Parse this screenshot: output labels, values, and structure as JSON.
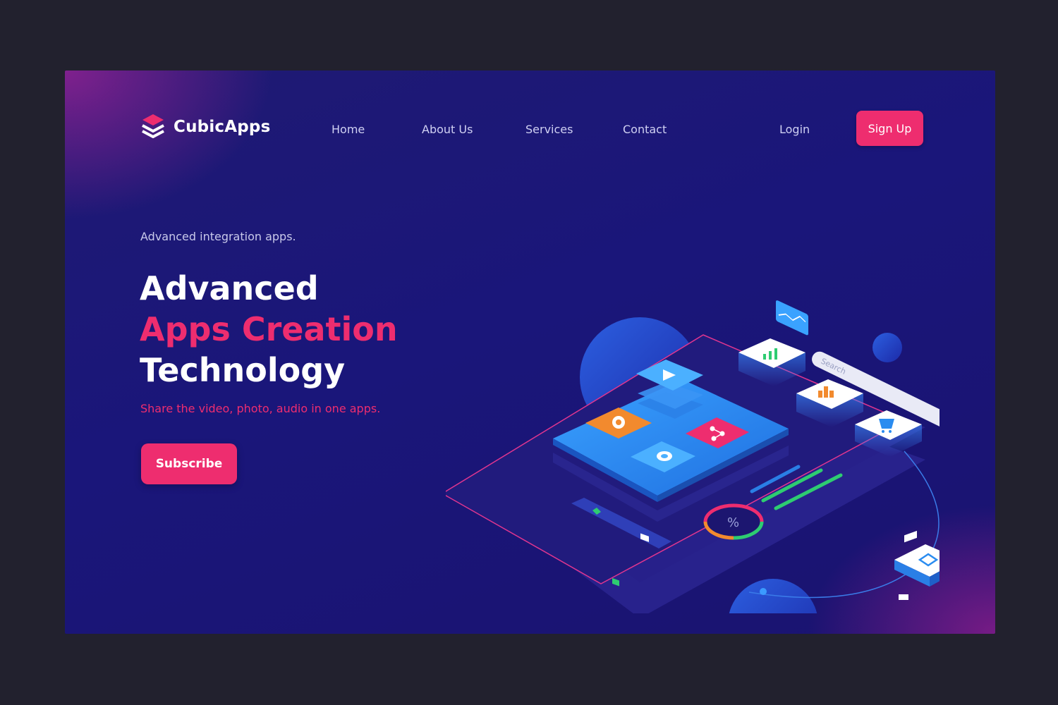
{
  "brand": {
    "name": "CubicApps",
    "logo_icon": "stacked-layers-icon"
  },
  "nav": {
    "items": [
      {
        "label": "Home"
      },
      {
        "label": "About Us"
      },
      {
        "label": "Services"
      },
      {
        "label": "Contact"
      }
    ],
    "login_label": "Login",
    "signup_label": "Sign Up"
  },
  "hero": {
    "eyebrow": "Advanced integration apps.",
    "headline_line1": "Advanced",
    "headline_line2": "Apps Creation",
    "headline_line3": "Technology",
    "tagline": "Share the video, photo, audio in one apps.",
    "cta_label": "Subscribe"
  },
  "illustration": {
    "search_placeholder": "Search",
    "percent_symbol": "%",
    "icons": [
      "play-icon",
      "gear-icon",
      "share-icon",
      "chat-icon",
      "bar-chart-icon",
      "chart-icon",
      "cart-icon",
      "rss-icon",
      "navigation-icon",
      "video-icon",
      "camera-icon"
    ]
  },
  "colors": {
    "accent": "#ee2d6f",
    "background": "#1c1775",
    "outer": "#22212e",
    "tile_blue": "#2a8cf0",
    "orange": "#f28a2e",
    "green": "#2ecc71"
  }
}
